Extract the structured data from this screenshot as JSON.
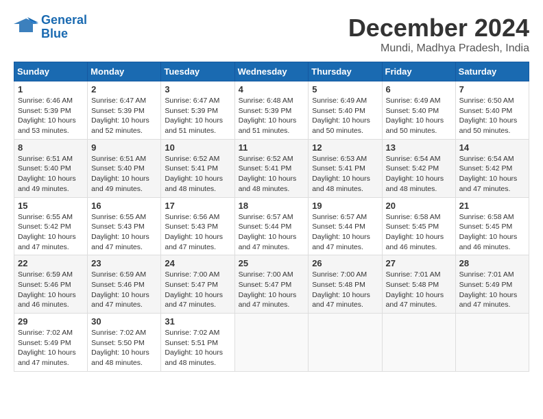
{
  "logo": {
    "line1": "General",
    "line2": "Blue"
  },
  "title": "December 2024",
  "location": "Mundi, Madhya Pradesh, India",
  "days_of_week": [
    "Sunday",
    "Monday",
    "Tuesday",
    "Wednesday",
    "Thursday",
    "Friday",
    "Saturday"
  ],
  "weeks": [
    [
      {
        "day": "1",
        "info": "Sunrise: 6:46 AM\nSunset: 5:39 PM\nDaylight: 10 hours\nand 53 minutes."
      },
      {
        "day": "2",
        "info": "Sunrise: 6:47 AM\nSunset: 5:39 PM\nDaylight: 10 hours\nand 52 minutes."
      },
      {
        "day": "3",
        "info": "Sunrise: 6:47 AM\nSunset: 5:39 PM\nDaylight: 10 hours\nand 51 minutes."
      },
      {
        "day": "4",
        "info": "Sunrise: 6:48 AM\nSunset: 5:39 PM\nDaylight: 10 hours\nand 51 minutes."
      },
      {
        "day": "5",
        "info": "Sunrise: 6:49 AM\nSunset: 5:40 PM\nDaylight: 10 hours\nand 50 minutes."
      },
      {
        "day": "6",
        "info": "Sunrise: 6:49 AM\nSunset: 5:40 PM\nDaylight: 10 hours\nand 50 minutes."
      },
      {
        "day": "7",
        "info": "Sunrise: 6:50 AM\nSunset: 5:40 PM\nDaylight: 10 hours\nand 50 minutes."
      }
    ],
    [
      {
        "day": "8",
        "info": "Sunrise: 6:51 AM\nSunset: 5:40 PM\nDaylight: 10 hours\nand 49 minutes."
      },
      {
        "day": "9",
        "info": "Sunrise: 6:51 AM\nSunset: 5:40 PM\nDaylight: 10 hours\nand 49 minutes."
      },
      {
        "day": "10",
        "info": "Sunrise: 6:52 AM\nSunset: 5:41 PM\nDaylight: 10 hours\nand 48 minutes."
      },
      {
        "day": "11",
        "info": "Sunrise: 6:52 AM\nSunset: 5:41 PM\nDaylight: 10 hours\nand 48 minutes."
      },
      {
        "day": "12",
        "info": "Sunrise: 6:53 AM\nSunset: 5:41 PM\nDaylight: 10 hours\nand 48 minutes."
      },
      {
        "day": "13",
        "info": "Sunrise: 6:54 AM\nSunset: 5:42 PM\nDaylight: 10 hours\nand 48 minutes."
      },
      {
        "day": "14",
        "info": "Sunrise: 6:54 AM\nSunset: 5:42 PM\nDaylight: 10 hours\nand 47 minutes."
      }
    ],
    [
      {
        "day": "15",
        "info": "Sunrise: 6:55 AM\nSunset: 5:42 PM\nDaylight: 10 hours\nand 47 minutes."
      },
      {
        "day": "16",
        "info": "Sunrise: 6:55 AM\nSunset: 5:43 PM\nDaylight: 10 hours\nand 47 minutes."
      },
      {
        "day": "17",
        "info": "Sunrise: 6:56 AM\nSunset: 5:43 PM\nDaylight: 10 hours\nand 47 minutes."
      },
      {
        "day": "18",
        "info": "Sunrise: 6:57 AM\nSunset: 5:44 PM\nDaylight: 10 hours\nand 47 minutes."
      },
      {
        "day": "19",
        "info": "Sunrise: 6:57 AM\nSunset: 5:44 PM\nDaylight: 10 hours\nand 47 minutes."
      },
      {
        "day": "20",
        "info": "Sunrise: 6:58 AM\nSunset: 5:45 PM\nDaylight: 10 hours\nand 46 minutes."
      },
      {
        "day": "21",
        "info": "Sunrise: 6:58 AM\nSunset: 5:45 PM\nDaylight: 10 hours\nand 46 minutes."
      }
    ],
    [
      {
        "day": "22",
        "info": "Sunrise: 6:59 AM\nSunset: 5:46 PM\nDaylight: 10 hours\nand 46 minutes."
      },
      {
        "day": "23",
        "info": "Sunrise: 6:59 AM\nSunset: 5:46 PM\nDaylight: 10 hours\nand 47 minutes."
      },
      {
        "day": "24",
        "info": "Sunrise: 7:00 AM\nSunset: 5:47 PM\nDaylight: 10 hours\nand 47 minutes."
      },
      {
        "day": "25",
        "info": "Sunrise: 7:00 AM\nSunset: 5:47 PM\nDaylight: 10 hours\nand 47 minutes."
      },
      {
        "day": "26",
        "info": "Sunrise: 7:00 AM\nSunset: 5:48 PM\nDaylight: 10 hours\nand 47 minutes."
      },
      {
        "day": "27",
        "info": "Sunrise: 7:01 AM\nSunset: 5:48 PM\nDaylight: 10 hours\nand 47 minutes."
      },
      {
        "day": "28",
        "info": "Sunrise: 7:01 AM\nSunset: 5:49 PM\nDaylight: 10 hours\nand 47 minutes."
      }
    ],
    [
      {
        "day": "29",
        "info": "Sunrise: 7:02 AM\nSunset: 5:49 PM\nDaylight: 10 hours\nand 47 minutes."
      },
      {
        "day": "30",
        "info": "Sunrise: 7:02 AM\nSunset: 5:50 PM\nDaylight: 10 hours\nand 48 minutes."
      },
      {
        "day": "31",
        "info": "Sunrise: 7:02 AM\nSunset: 5:51 PM\nDaylight: 10 hours\nand 48 minutes."
      },
      {
        "day": "",
        "info": ""
      },
      {
        "day": "",
        "info": ""
      },
      {
        "day": "",
        "info": ""
      },
      {
        "day": "",
        "info": ""
      }
    ]
  ]
}
